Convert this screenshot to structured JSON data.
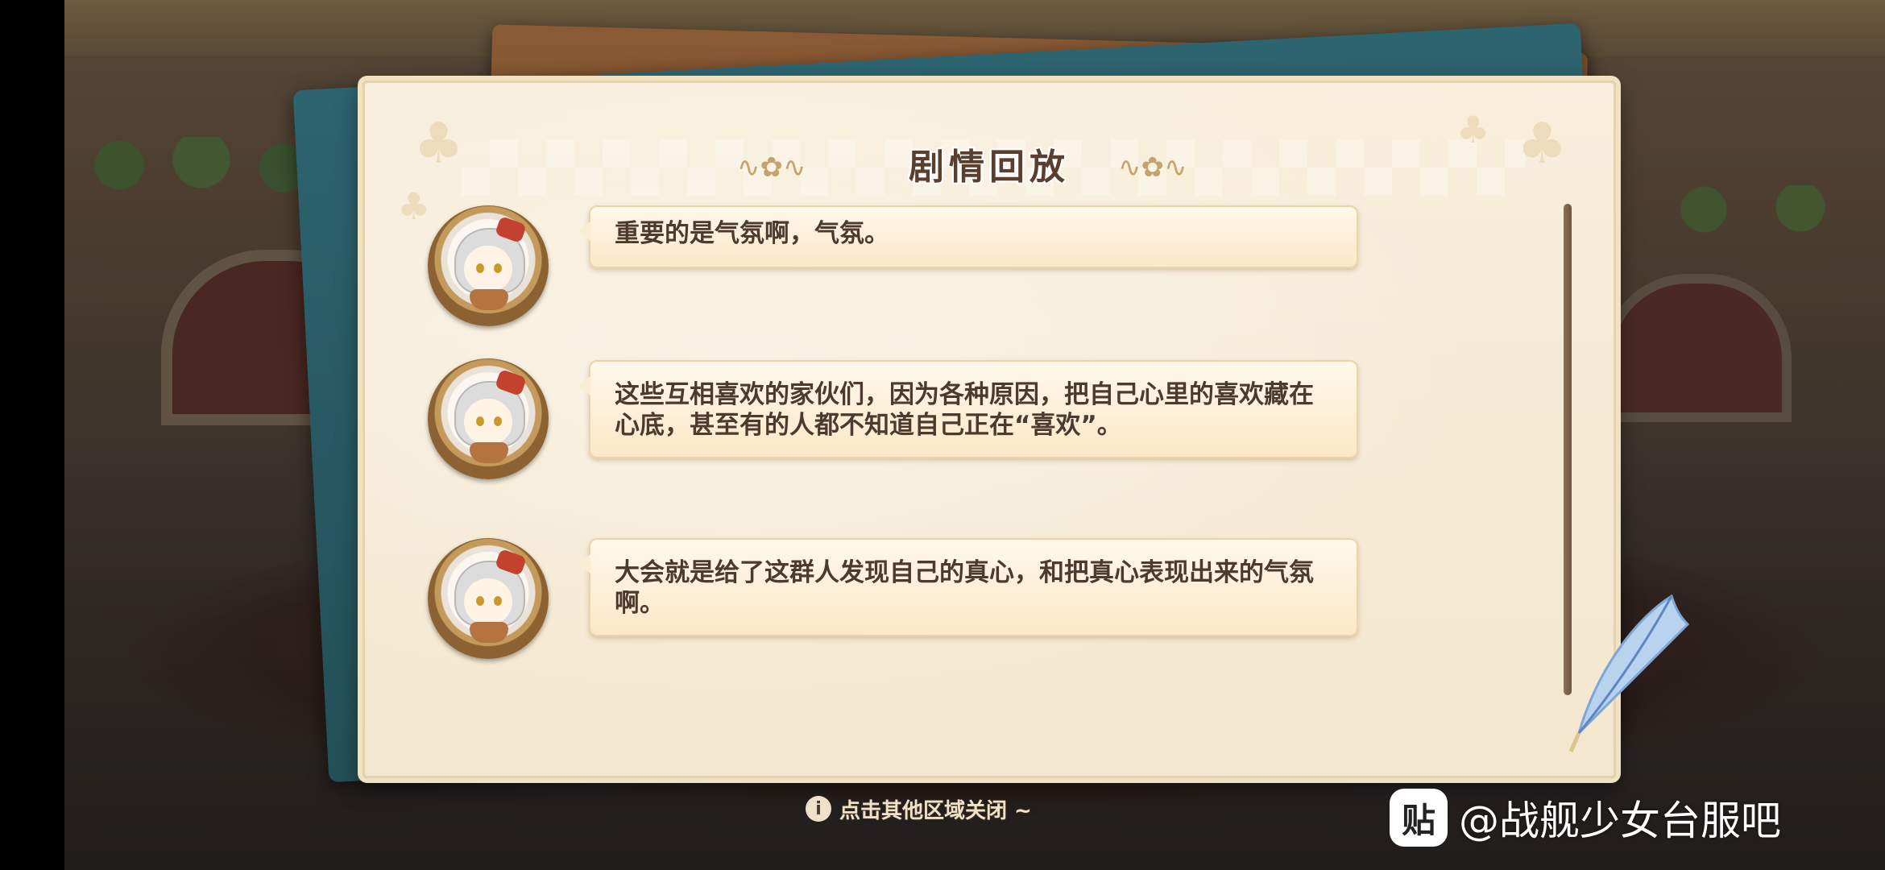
{
  "dialog": {
    "title": "剧情回放",
    "entries": [
      {
        "speaker_icon": "silver-hair-girl-avatar",
        "text": "重要的是气氛啊，气氛。"
      },
      {
        "speaker_icon": "silver-hair-girl-avatar",
        "text": "这些互相喜欢的家伙们，因为各种原因，把自己心里的喜欢藏在心底，甚至有的人都不知道自己正在“喜欢”。"
      },
      {
        "speaker_icon": "silver-hair-girl-avatar",
        "text": "大会就是给了这群人发现自己的真心，和把真心表现出来的气氛啊。"
      }
    ]
  },
  "footer": {
    "hint_icon": "info-icon",
    "hint": "点击其他区域关闭 ~"
  },
  "watermark": {
    "logo": "贴",
    "text": "@战舰少女台服吧"
  },
  "colors": {
    "panel": "#f6ebd4",
    "bubble": "#fbe8c9",
    "text": "#4d3a2e",
    "accent": "#c7a36c"
  }
}
